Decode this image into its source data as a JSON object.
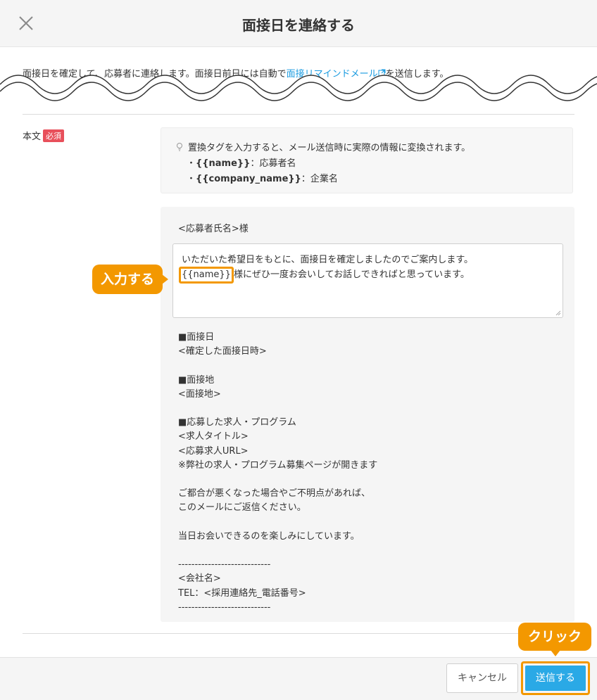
{
  "header": {
    "title": "面接日を連絡する",
    "close_icon": "close-icon"
  },
  "notice": {
    "text_before": "面接日を確定して、応募者に連絡します。面接日前日には自動で",
    "link": "面接リマインドメール",
    "text_after": "を送信します。"
  },
  "field": {
    "label": "本文",
    "required": "必須"
  },
  "hint": {
    "intro": "置換タグを入力すると、メール送信時に実際の情報に変換されます。",
    "items": [
      {
        "bullet": "・",
        "tag": "{{name}}",
        "desc": "：応募者名"
      },
      {
        "bullet": "・",
        "tag": "{{company_name}}",
        "desc": "：企業名"
      }
    ]
  },
  "editor": {
    "greeting": "<応募者氏名>様",
    "textarea_line1": "いただいた希望日をもとに、面接日を確定しましたのでご案内します。",
    "textarea_tag": "{{name}}",
    "textarea_line2_rest": "様にぜひ一度お会いしてお話しできればと思っています。",
    "lines": [
      "■面接日",
      "<確定した面接日時>",
      "",
      "■面接地",
      "<面接地>",
      "",
      "■応募した求人・プログラム",
      "<求人タイトル>",
      "<応募求人URL>",
      "※弊社の求人・プログラム募集ページが開きます",
      "",
      "ご都合が悪くなった場合やご不明点があれば、",
      "このメールにご返信ください。",
      "",
      "当日お会いできるのを楽しみにしています。",
      "",
      "----------------------------",
      "<会社名>",
      "TEL：<採用連絡先_電話番号>",
      "----------------------------"
    ]
  },
  "annotations": {
    "input_callout": "入力する",
    "click_callout": "クリック"
  },
  "footer": {
    "cancel_label": "キャンセル",
    "send_label": "送信する"
  },
  "colors": {
    "accent": "#f39800",
    "primary": "#2aa9e6",
    "link": "#1a9be0",
    "required": "#e8505b"
  }
}
